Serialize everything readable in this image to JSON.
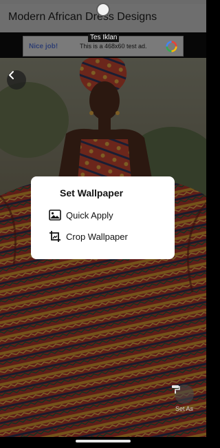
{
  "app": {
    "title": "Modern African Dress Designs"
  },
  "ad": {
    "label": "Tes Iklan",
    "nice": "Nice job!",
    "text": "This is a 468x60 test ad.",
    "logo_icon": "ad-choices-logo"
  },
  "dialog": {
    "title": "Set Wallpaper",
    "options": [
      {
        "label": "Quick Apply",
        "icon": "image-icon"
      },
      {
        "label": "Crop Wallpaper",
        "icon": "crop-icon"
      }
    ]
  },
  "actions": {
    "set_as_label": "Set As"
  },
  "colors": {
    "app_bar": "#6e6e6e",
    "dialog_bg": "#ffffff",
    "dress_red": "#a4332a",
    "dress_gold": "#c8922e"
  }
}
